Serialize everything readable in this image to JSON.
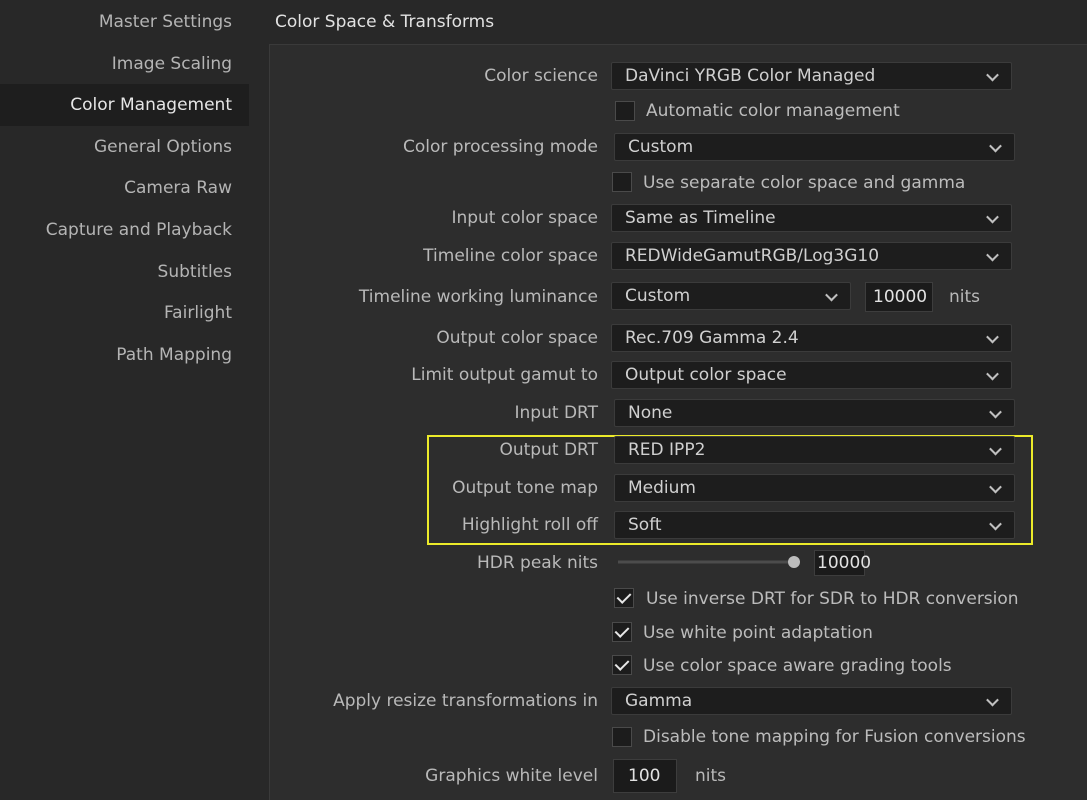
{
  "sidebar": {
    "items": [
      {
        "label": "Master Settings"
      },
      {
        "label": "Image Scaling"
      },
      {
        "label": "Color Management"
      },
      {
        "label": "General Options"
      },
      {
        "label": "Camera Raw"
      },
      {
        "label": "Capture and Playback"
      },
      {
        "label": "Subtitles"
      },
      {
        "label": "Fairlight"
      },
      {
        "label": "Path Mapping"
      }
    ],
    "active": "Color Management"
  },
  "section_title": "Color Space & Transforms",
  "settings": {
    "color_science": {
      "label": "Color science",
      "value": "DaVinci YRGB Color Managed"
    },
    "auto_color_mgmt": {
      "label": "Automatic color management",
      "checked": false
    },
    "processing_mode": {
      "label": "Color processing mode",
      "value": "Custom"
    },
    "separate_cs_gamma": {
      "label": "Use separate color space and gamma",
      "checked": false
    },
    "input_cs": {
      "label": "Input color space",
      "value": "Same as Timeline"
    },
    "timeline_cs": {
      "label": "Timeline color space",
      "value": "REDWideGamutRGB/Log3G10"
    },
    "timeline_lum": {
      "label": "Timeline working luminance",
      "value": "Custom",
      "nits_value": "10000",
      "unit": "nits"
    },
    "output_cs": {
      "label": "Output color space",
      "value": "Rec.709 Gamma 2.4"
    },
    "limit_gamut": {
      "label": "Limit output gamut to",
      "value": "Output color space"
    },
    "input_drt": {
      "label": "Input DRT",
      "value": "None"
    },
    "output_drt": {
      "label": "Output DRT",
      "value": "RED IPP2"
    },
    "tone_map": {
      "label": "Output tone map",
      "value": "Medium"
    },
    "rolloff": {
      "label": "Highlight roll off",
      "value": "Soft"
    },
    "hdr_peak": {
      "label": "HDR peak nits",
      "value": "10000",
      "slider_fraction": 0.95
    },
    "inverse_drt": {
      "label": "Use inverse DRT for SDR to HDR conversion",
      "checked": true
    },
    "white_point": {
      "label": "Use white point adaptation",
      "checked": true
    },
    "cs_aware": {
      "label": "Use color space aware grading tools",
      "checked": true
    },
    "resize": {
      "label": "Apply resize transformations in",
      "value": "Gamma"
    },
    "fusion_tonemap": {
      "label": "Disable tone mapping for Fusion conversions",
      "checked": false
    },
    "graphics_white": {
      "label": "Graphics white level",
      "value": "100",
      "unit": "nits"
    }
  },
  "colors": {
    "highlight_box": "#ecea2a",
    "background": "#282828",
    "panel": "#2d2d2d",
    "field": "#1d1d1d"
  }
}
